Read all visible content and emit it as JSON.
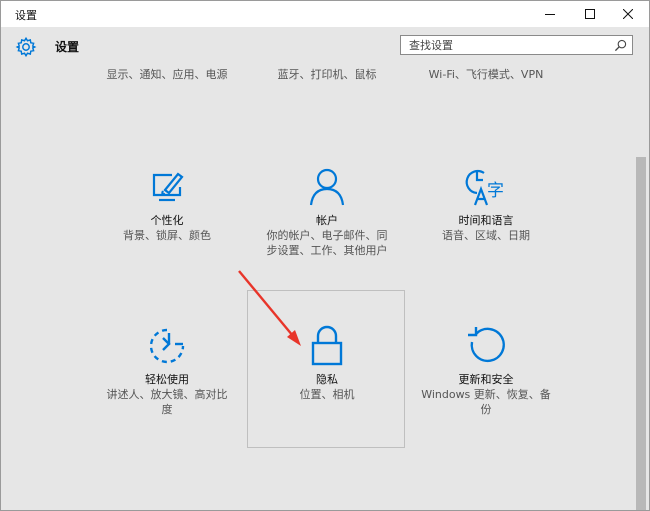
{
  "window": {
    "title": "设置"
  },
  "header": {
    "title": "设置"
  },
  "search": {
    "placeholder": "查找设置"
  },
  "top_tiles": [
    {
      "desc": "显示、通知、应用、电源"
    },
    {
      "desc": "蓝牙、打印机、鼠标"
    },
    {
      "desc": "Wi-Fi、飞行模式、VPN"
    }
  ],
  "tiles": [
    {
      "name": "个性化",
      "desc": "背景、锁屏、颜色",
      "icon": "personalization-icon"
    },
    {
      "name": "帐户",
      "desc": "你的帐户、电子邮件、同步设置、工作、其他用户",
      "icon": "account-icon"
    },
    {
      "name": "时间和语言",
      "desc": "语音、区域、日期",
      "icon": "time-language-icon"
    },
    {
      "name": "轻松使用",
      "desc": "讲述人、放大镜、高对比度",
      "icon": "ease-of-access-icon"
    },
    {
      "name": "隐私",
      "desc": "位置、相机",
      "icon": "lock-icon"
    },
    {
      "name": "更新和安全",
      "desc": "Windows 更新、恢复、备份",
      "icon": "update-icon"
    }
  ],
  "colors": {
    "accent": "#0078d7",
    "arrow": "#e8352a",
    "background": "#e6e6e6"
  }
}
